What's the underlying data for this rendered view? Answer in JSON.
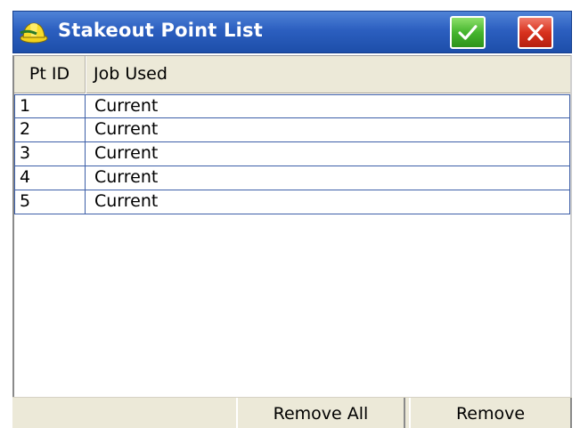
{
  "window": {
    "title": "Stakeout Point List",
    "icon": "hard-hat-icon",
    "ok_icon": "checkmark-icon",
    "close_icon": "close-x-icon"
  },
  "table": {
    "columns": [
      "Pt ID",
      "Job Used"
    ],
    "rows": [
      {
        "pt_id": "1",
        "job_used": "Current"
      },
      {
        "pt_id": "2",
        "job_used": "Current"
      },
      {
        "pt_id": "3",
        "job_used": "Current"
      },
      {
        "pt_id": "4",
        "job_used": "Current"
      },
      {
        "pt_id": "5",
        "job_used": "Current"
      }
    ]
  },
  "buttons": {
    "remove_all": "Remove All",
    "remove": "Remove"
  },
  "colors": {
    "titlebar": "#2c5fc0",
    "ok_button": "#45b52e",
    "close_button": "#d8321e",
    "row_border": "#3d5fa8",
    "chrome": "#ece9d8"
  }
}
